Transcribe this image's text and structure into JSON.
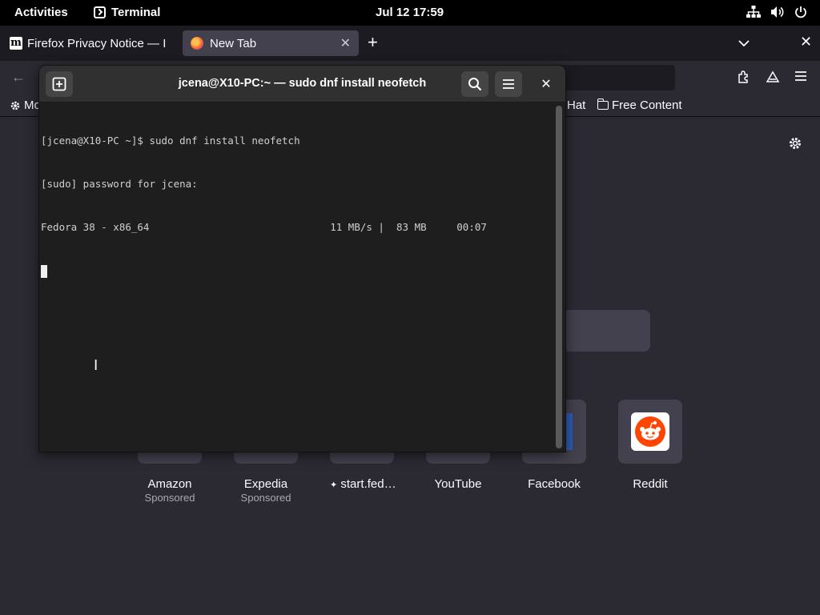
{
  "topbar": {
    "activities": "Activities",
    "app_name": "Terminal",
    "clock": "Jul 12  17:59",
    "tray_icons": [
      "network-icon",
      "volume-icon",
      "power-icon"
    ]
  },
  "firefox": {
    "tabs": [
      {
        "label": "Firefox Privacy Notice — I",
        "favicon": "mozilla-m-icon",
        "active": false
      },
      {
        "label": "New Tab",
        "favicon": "firefox-icon",
        "active": true
      }
    ],
    "bookmarks": {
      "first": "Mo",
      "red_hat": "Hat",
      "free_content": "Free Content"
    },
    "top_sites": [
      {
        "title": "Amazon",
        "sub": "Sponsored"
      },
      {
        "title": "Expedia",
        "sub": "Sponsored"
      },
      {
        "title": "start.fed…",
        "sub": ""
      },
      {
        "title": "YouTube",
        "sub": ""
      },
      {
        "title": "Facebook",
        "sub": ""
      },
      {
        "title": "Reddit",
        "sub": ""
      }
    ],
    "colors": {
      "toolbar": "#2b2a33",
      "tabstrip": "#1c1b22",
      "tile": "#42414d"
    }
  },
  "terminal": {
    "title": "jcena@X10-PC:~ — sudo dnf install neofetch",
    "lines": [
      "[jcena@X10-PC ~]$ sudo dnf install neofetch",
      "[sudo] password for jcena:",
      "Fedora 38 - x86_64                              11 MB/s |  83 MB     00:07"
    ],
    "colors": {
      "background": "#1e1e1e",
      "header": "#303030",
      "text": "#d0d0d0"
    }
  }
}
